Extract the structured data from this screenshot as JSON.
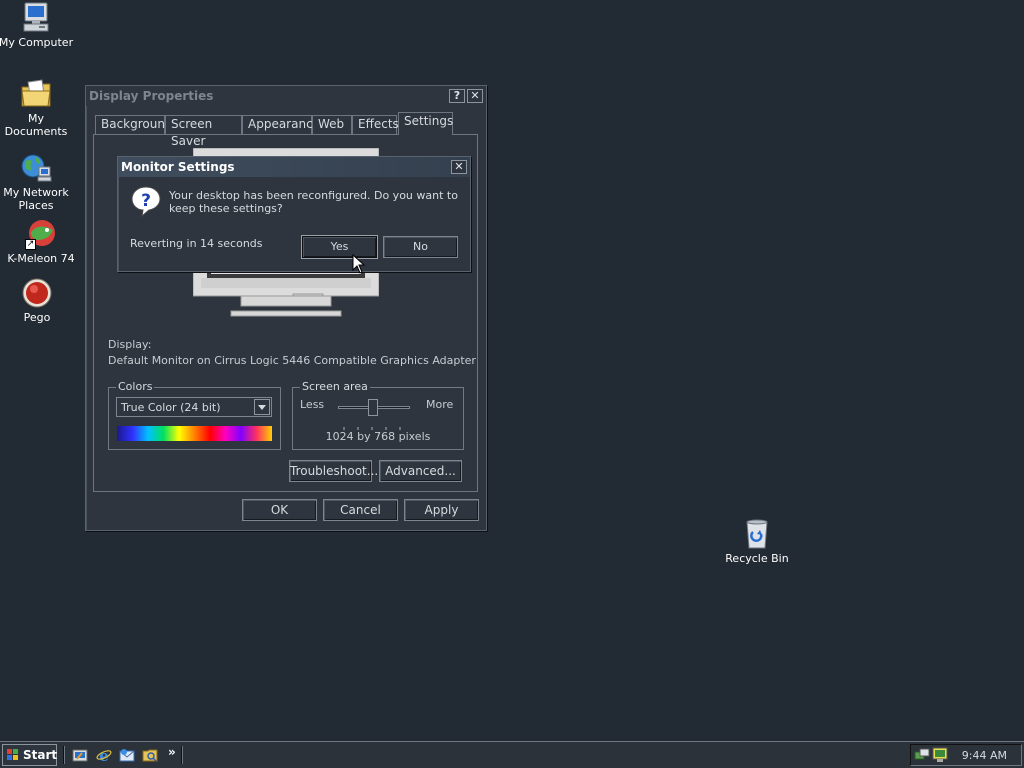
{
  "desktop": {
    "icons": [
      {
        "label": "My Computer",
        "icon": "computer-icon"
      },
      {
        "label": "My Documents",
        "icon": "folder-documents-icon"
      },
      {
        "label": "My Network Places",
        "icon": "network-icon"
      },
      {
        "label": "K-Meleon 74",
        "icon": "kmeleon-icon"
      },
      {
        "label": "Pego",
        "icon": "pego-icon"
      },
      {
        "label": "Recycle Bin",
        "icon": "recycle-bin-icon"
      }
    ]
  },
  "display_properties": {
    "title": "Display Properties",
    "help_btn": "?",
    "close_btn": "✕",
    "tabs": [
      "Background",
      "Screen Saver",
      "Appearance",
      "Web",
      "Effects",
      "Settings"
    ],
    "active_tab": "Settings",
    "display_label": "Display:",
    "display_value": "Default Monitor on Cirrus Logic 5446 Compatible Graphics Adapter",
    "colors_legend": "Colors",
    "colors_value": "True Color (24 bit)",
    "screen_area_legend": "Screen area",
    "less_label": "Less",
    "more_label": "More",
    "resolution": "1024 by 768 pixels",
    "troubleshoot_btn": "Troubleshoot...",
    "advanced_btn": "Advanced...",
    "ok_btn": "OK",
    "cancel_btn": "Cancel",
    "apply_btn": "Apply"
  },
  "monitor_settings": {
    "title": "Monitor Settings",
    "close_btn": "✕",
    "message": "Your desktop has been reconfigured.  Do you want to keep these settings?",
    "countdown": "Reverting in 14 seconds",
    "yes_btn": "Yes",
    "no_btn": "No"
  },
  "taskbar": {
    "start_label": "Start",
    "chevron": "»",
    "clock": "9:44 AM"
  },
  "colors": {
    "desktop_bg": "#222a33",
    "window_bg": "#2e353e",
    "dialog_title_bg": "#3d4a5a"
  }
}
